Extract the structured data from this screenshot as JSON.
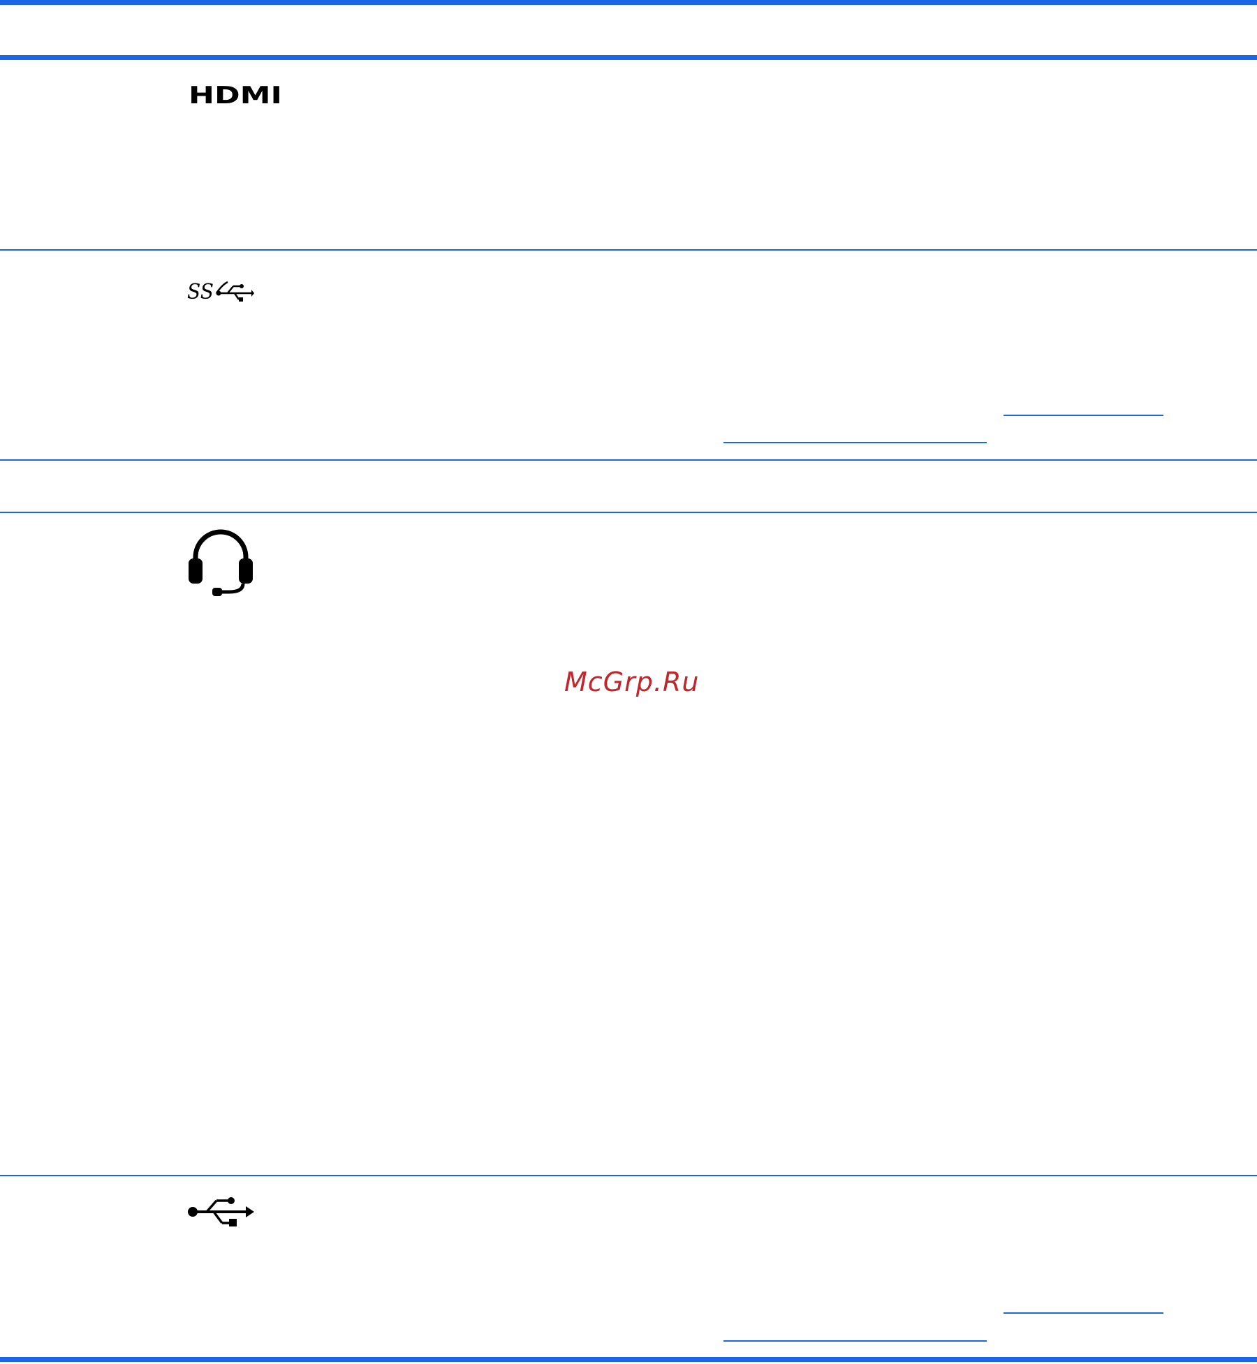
{
  "table": {
    "rows": [
      {
        "icon": "hdmi-port-icon",
        "icon_text": "HDMI"
      },
      {
        "icon": "usb-3-superspeed-icon",
        "icon_text": "SS"
      },
      {
        "icon": "none"
      },
      {
        "icon": "headset-audio-jack-icon"
      },
      {
        "icon": "usb-icon"
      }
    ]
  },
  "watermark": {
    "text": "McGrp.Ru",
    "color": "#c0272d"
  },
  "colors": {
    "rule": "#1a66e6",
    "icon": "#000000",
    "background": "#ffffff"
  }
}
